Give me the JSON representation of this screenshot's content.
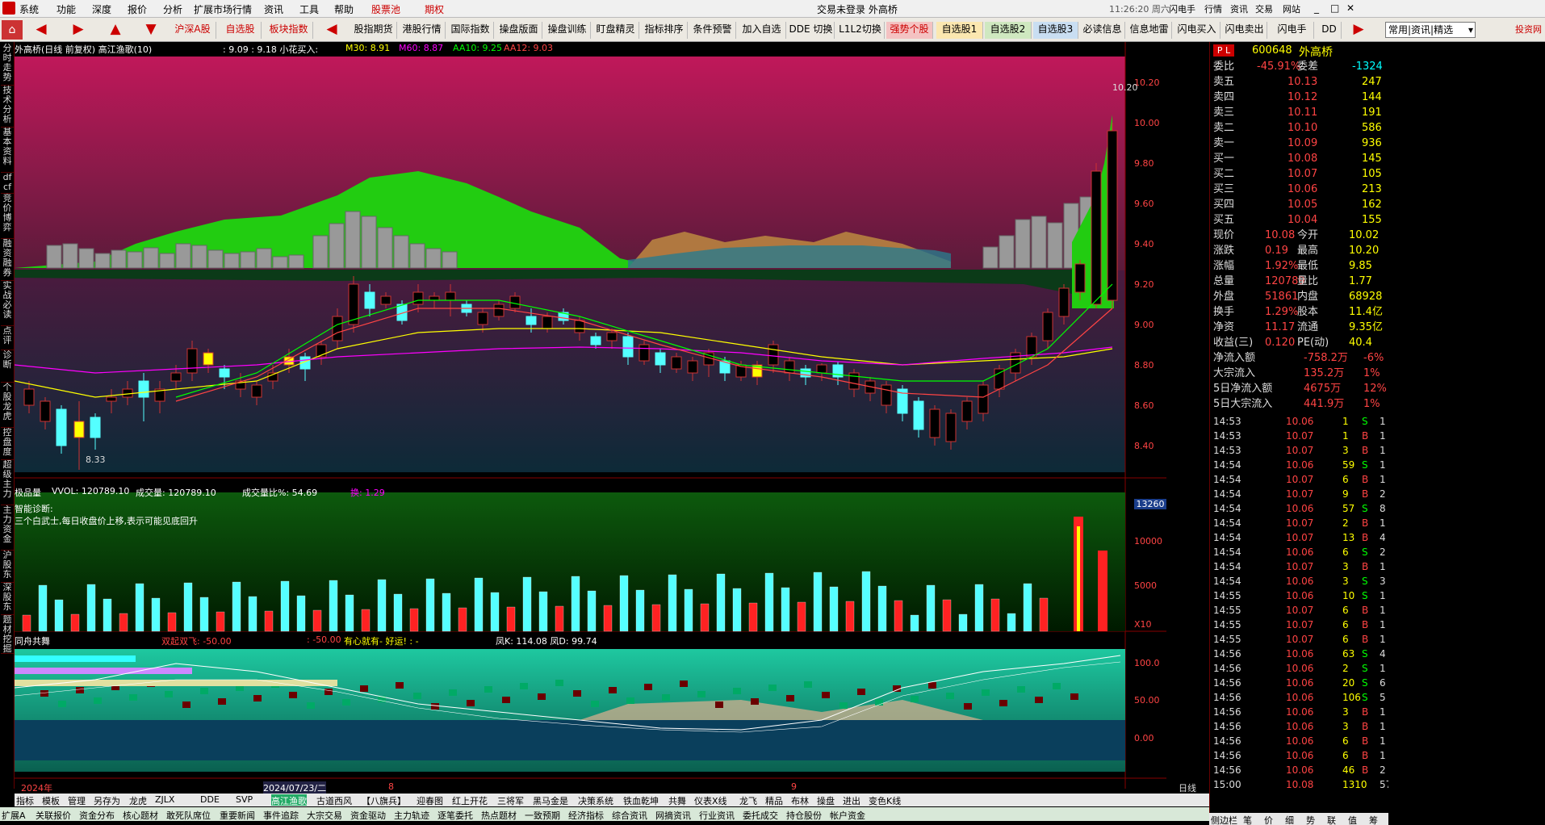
{
  "menu": {
    "items": [
      "系统",
      "功能",
      "深度",
      "报价",
      "分析",
      "扩展市场行情",
      "资讯",
      "工具",
      "帮助",
      "股票池",
      "期权"
    ],
    "center_title": "交易未登录 外高桥",
    "time": "11:26:20 周六",
    "right": [
      "闪电手",
      "行情",
      "资讯",
      "交易",
      "网站"
    ]
  },
  "toolbar": {
    "items": [
      "沪深A股",
      "自选股",
      "板块指数",
      "股指期货",
      "港股行情",
      "国际指数",
      "操盘版面",
      "操盘训练",
      "盯盘精灵",
      "指标排序",
      "条件预警",
      "加入自选",
      "DDE 切换",
      "L1L2切换",
      "强势个股",
      "自选股1",
      "自选股2",
      "自选股3",
      "必读信息",
      "信息地雷",
      "闪电买入",
      "闪电卖出",
      "闪电手",
      "DD"
    ],
    "dropdown": "常用|资讯|精选",
    "brand": "投资网"
  },
  "sidebar": [
    "分时走势",
    "技术分析",
    "基本资料",
    "dfcf",
    "竞价博弈",
    "融资融券",
    "实战必读",
    "点评",
    "诊断",
    "个股龙虎",
    "控盘度",
    "超级主力",
    "主力资金",
    "沪股东",
    "深股东",
    "题材挖掘"
  ],
  "chart_header": {
    "name": "外高桥(日线 前复权) 高江渔歌(10)",
    "vals": ": 9.09 : 9.18 小花买入:",
    "ma30": "M30: 8.91",
    "ma60": "M60: 8.87",
    "aa10": "AA10: 9.25",
    "aa12": "AA12: 9.03"
  },
  "price_axis": [
    "10.20",
    "10.00",
    "9.80",
    "9.60",
    "9.40",
    "9.20",
    "9.00",
    "8.80",
    "8.60",
    "8.40"
  ],
  "price_labels": {
    "high": "10.20",
    "low": "8.33"
  },
  "vol_header": {
    "name": "极品量",
    "vvol": "VVOL: 120789.10",
    "cjl": "成交量: 120789.10",
    "ratio": "成交量比%: 54.69",
    "huan": "换: 1.29"
  },
  "diagnosis": {
    "title": "智能诊断:",
    "text": "三个白武士,每日收盘价上移,表示可能见底回升"
  },
  "vol_axis": [
    "13260",
    "10000",
    "5000",
    "X10"
  ],
  "ind_header": {
    "name": "同舟共舞",
    "a": "双起双飞: -50.00",
    "b": ": -50.00",
    "c": "有心就有- 好运! : -",
    "d": "凤K: 114.08 凤D: 99.74"
  },
  "ind_axis": [
    "100.0",
    "50.00",
    "0.00"
  ],
  "date_axis": {
    "year": "2024年",
    "date": "2024/07/23/二",
    "m8": "8",
    "m9": "9",
    "period": "日线"
  },
  "quote": {
    "code": "600648",
    "name": "外高桥",
    "weibi": [
      "委比",
      "-45.91%",
      "委差",
      "-1324"
    ],
    "sells": [
      [
        "卖五",
        "10.13",
        "247"
      ],
      [
        "卖四",
        "10.12",
        "144"
      ],
      [
        "卖三",
        "10.11",
        "191"
      ],
      [
        "卖二",
        "10.10",
        "586"
      ],
      [
        "卖一",
        "10.09",
        "936"
      ]
    ],
    "buys": [
      [
        "买一",
        "10.08",
        "145"
      ],
      [
        "买二",
        "10.07",
        "105"
      ],
      [
        "买三",
        "10.06",
        "213"
      ],
      [
        "买四",
        "10.05",
        "162"
      ],
      [
        "买五",
        "10.04",
        "155"
      ]
    ],
    "stats": [
      [
        "现价",
        "10.08",
        "今开",
        "10.02"
      ],
      [
        "涨跌",
        "0.19",
        "最高",
        "10.20"
      ],
      [
        "涨幅",
        "1.92%",
        "最低",
        "9.85"
      ],
      [
        "总量",
        "120789",
        "量比",
        "1.77"
      ],
      [
        "外盘",
        "51861",
        "内盘",
        "68928"
      ],
      [
        "换手",
        "1.29%",
        "股本",
        "11.4亿"
      ],
      [
        "净资",
        "11.17",
        "流通",
        "9.35亿"
      ],
      [
        "收益(三)",
        "0.120",
        "PE(动)",
        "40.4"
      ]
    ],
    "flows": [
      [
        "净流入额",
        "-758.2万",
        "-6%"
      ],
      [
        "大宗流入",
        "135.2万",
        "1%"
      ],
      [
        "5日净流入额",
        "4675万",
        "12%"
      ],
      [
        "5日大宗流入",
        "441.9万",
        "1%"
      ]
    ]
  },
  "trades": [
    [
      "14:53",
      "10.06",
      "1",
      "S",
      "1"
    ],
    [
      "14:53",
      "10.07",
      "1",
      "B",
      "1"
    ],
    [
      "14:53",
      "10.07",
      "3",
      "B",
      "1"
    ],
    [
      "14:54",
      "10.06",
      "59",
      "S",
      "1"
    ],
    [
      "14:54",
      "10.07",
      "6",
      "B",
      "1"
    ],
    [
      "14:54",
      "10.07",
      "9",
      "B",
      "2"
    ],
    [
      "14:54",
      "10.06",
      "57",
      "S",
      "8"
    ],
    [
      "14:54",
      "10.07",
      "2",
      "B",
      "1"
    ],
    [
      "14:54",
      "10.07",
      "13",
      "B",
      "4"
    ],
    [
      "14:54",
      "10.06",
      "6",
      "S",
      "2"
    ],
    [
      "14:54",
      "10.07",
      "3",
      "B",
      "1"
    ],
    [
      "14:54",
      "10.06",
      "3",
      "S",
      "3"
    ],
    [
      "14:55",
      "10.06",
      "10",
      "S",
      "1"
    ],
    [
      "14:55",
      "10.07",
      "6",
      "B",
      "1"
    ],
    [
      "14:55",
      "10.07",
      "6",
      "B",
      "1"
    ],
    [
      "14:55",
      "10.07",
      "6",
      "B",
      "1"
    ],
    [
      "14:56",
      "10.06",
      "63",
      "S",
      "4"
    ],
    [
      "14:56",
      "10.06",
      "2",
      "S",
      "1"
    ],
    [
      "14:56",
      "10.06",
      "20",
      "S",
      "6"
    ],
    [
      "14:56",
      "10.06",
      "106",
      "S",
      "5"
    ],
    [
      "14:56",
      "10.06",
      "3",
      "B",
      "1"
    ],
    [
      "14:56",
      "10.06",
      "3",
      "B",
      "1"
    ],
    [
      "14:56",
      "10.06",
      "6",
      "B",
      "1"
    ],
    [
      "14:56",
      "10.06",
      "6",
      "B",
      "1"
    ],
    [
      "14:56",
      "10.06",
      "46",
      "B",
      "2"
    ],
    [
      "15:00",
      "10.08",
      "1310",
      "",
      "57"
    ]
  ],
  "bottom_tabs1": [
    "指标",
    "模板",
    "管理",
    "另存为",
    "龙虎",
    "ZJLX",
    "DDE",
    "SVP",
    "高江渔歌",
    "古道西风",
    "【八旗兵】",
    "迎春图",
    "红上开花",
    "三将军",
    "黑马金是",
    "决策系统",
    "铁血乾坤",
    "共舞",
    "仪表X线",
    "龙飞",
    "精品",
    "布林",
    "操盘",
    "进出",
    "变色K线"
  ],
  "bottom_tabs2": [
    "扩展A",
    "关联报价",
    "资金分布",
    "核心题材",
    "敢死队席位",
    "重要新闻",
    "事件追踪",
    "大宗交易",
    "资金驱动",
    "主力轨迹",
    "逐笔委托",
    "热点题材",
    "一致预期",
    "经济指标",
    "综合资讯",
    "网摘资讯",
    "行业资讯",
    "委托成交",
    "持仓股份",
    "帐户资金"
  ],
  "right_bottom": [
    "侧边栏",
    "笔",
    "价",
    "细",
    "势",
    "联",
    "值",
    "筹"
  ],
  "colors": {
    "up": "#ff3c3c",
    "down": "#54ffff",
    "accent": "#ffff00"
  }
}
